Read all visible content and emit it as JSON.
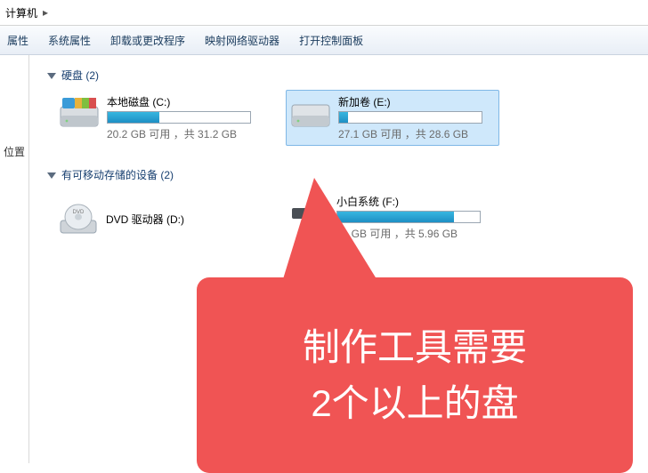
{
  "breadcrumb": {
    "root": "计算机"
  },
  "toolbar": {
    "prop": "属性",
    "sysprop": "系统属性",
    "uninstall": "卸载或更改程序",
    "mapdrv": "映射网络驱动器",
    "ctrl": "打开控制面板"
  },
  "sidebar": {
    "loc": "位置"
  },
  "groups": {
    "hdd": {
      "title": "硬盘 (2)"
    },
    "removable": {
      "title": "有可移动存储的设备 (2)"
    }
  },
  "drives": {
    "c": {
      "name": "本地磁盘 (C:)",
      "status": "20.2 GB 可用 ，共 31.2 GB",
      "pct": 36
    },
    "e": {
      "name": "新加卷 (E:)",
      "status": "27.1 GB 可用 ，共 28.6 GB",
      "pct": 6
    },
    "d": {
      "name": "DVD 驱动器 (D:)"
    },
    "f": {
      "name": "小白系统 (F:)",
      "status": "01 GB 可用 ，共 5.96 GB",
      "pct": 82
    }
  },
  "annotation": {
    "line1": "制作工具需要",
    "line2": "2个以上的盘"
  }
}
